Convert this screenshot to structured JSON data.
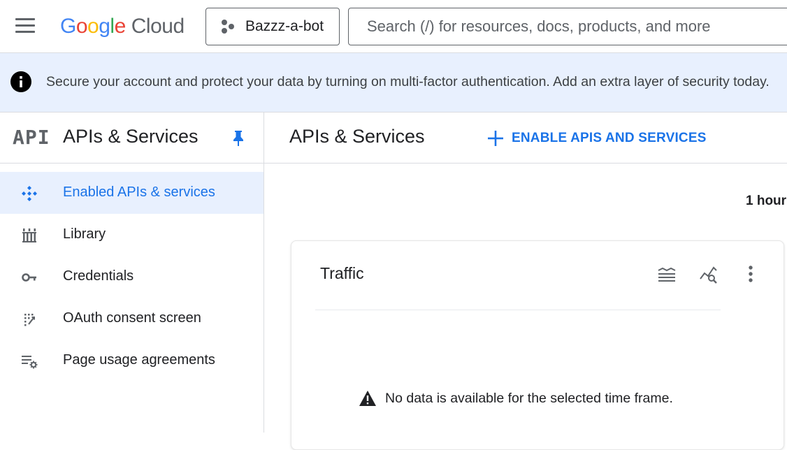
{
  "header": {
    "logo": {
      "g1": "G",
      "o1": "o",
      "o2": "o",
      "g2": "g",
      "l": "l",
      "e": "e",
      "cloud": "Cloud"
    },
    "project_name": "Bazzz-a-bot",
    "search_placeholder": "Search (/) for resources, docs, products, and more"
  },
  "banner": {
    "text": "Secure your account and protect your data by turning on multi-factor authentication. Add an extra layer of security today."
  },
  "sidebar": {
    "logo_text": "API",
    "title": "APIs & Services",
    "items": [
      {
        "label": "Enabled APIs & services",
        "icon": "diamond-dots-icon",
        "active": true
      },
      {
        "label": "Library",
        "icon": "library-icon",
        "active": false
      },
      {
        "label": "Credentials",
        "icon": "key-icon",
        "active": false
      },
      {
        "label": "OAuth consent screen",
        "icon": "consent-icon",
        "active": false
      },
      {
        "label": "Page usage agreements",
        "icon": "settings-list-icon",
        "active": false
      }
    ]
  },
  "main": {
    "title": "APIs & Services",
    "enable_button": "ENABLE APIS AND SERVICES",
    "time_range": "1 hour",
    "traffic_card": {
      "title": "Traffic",
      "empty_message": "No data is available for the selected time frame."
    }
  },
  "colors": {
    "accent": "#1a73e8",
    "banner_bg": "#e8f0fe",
    "text": "#202124",
    "icon_gray": "#5f6368"
  }
}
